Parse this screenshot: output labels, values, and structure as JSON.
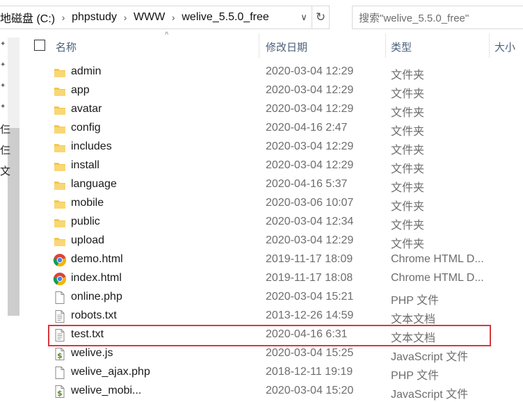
{
  "address_bar": {
    "crumbs": [
      "地磁盘 (C:)",
      "phpstudy",
      "WWW",
      "welive_5.5.0_free"
    ]
  },
  "search": {
    "placeholder": "搜索\"welive_5.5.0_free\""
  },
  "nav_pane": {
    "labels": [
      "仨",
      "仨",
      "文"
    ]
  },
  "columns": {
    "name": "名称",
    "date": "修改日期",
    "type": "类型",
    "size": "大小"
  },
  "files": [
    {
      "name": "admin",
      "date": "2020-03-04 12:29",
      "type": "文件夹",
      "icon": "folder-icon"
    },
    {
      "name": "app",
      "date": "2020-03-04 12:29",
      "type": "文件夹",
      "icon": "folder-icon"
    },
    {
      "name": "avatar",
      "date": "2020-03-04 12:29",
      "type": "文件夹",
      "icon": "folder-icon"
    },
    {
      "name": "config",
      "date": "2020-04-16 2:47",
      "type": "文件夹",
      "icon": "folder-icon"
    },
    {
      "name": "includes",
      "date": "2020-03-04 12:29",
      "type": "文件夹",
      "icon": "folder-icon"
    },
    {
      "name": "install",
      "date": "2020-03-04 12:29",
      "type": "文件夹",
      "icon": "folder-icon"
    },
    {
      "name": "language",
      "date": "2020-04-16 5:37",
      "type": "文件夹",
      "icon": "folder-icon"
    },
    {
      "name": "mobile",
      "date": "2020-03-06 10:07",
      "type": "文件夹",
      "icon": "folder-icon"
    },
    {
      "name": "public",
      "date": "2020-03-04 12:34",
      "type": "文件夹",
      "icon": "folder-icon"
    },
    {
      "name": "upload",
      "date": "2020-03-04 12:29",
      "type": "文件夹",
      "icon": "folder-icon"
    },
    {
      "name": "demo.html",
      "date": "2019-11-17 18:09",
      "type": "Chrome HTML D...",
      "icon": "chrome-icon"
    },
    {
      "name": "index.html",
      "date": "2019-11-17 18:08",
      "type": "Chrome HTML D...",
      "icon": "chrome-icon"
    },
    {
      "name": "online.php",
      "date": "2020-03-04 15:21",
      "type": "PHP 文件",
      "icon": "file-icon"
    },
    {
      "name": "robots.txt",
      "date": "2013-12-26 14:59",
      "type": "文本文档",
      "icon": "text-file-icon"
    },
    {
      "name": "test.txt",
      "date": "2020-04-16 6:31",
      "type": "文本文档",
      "icon": "text-file-icon"
    },
    {
      "name": "welive.js",
      "date": "2020-03-04 15:25",
      "type": "JavaScript 文件",
      "icon": "script-icon"
    },
    {
      "name": "welive_ajax.php",
      "date": "2018-12-11 19:19",
      "type": "PHP 文件",
      "icon": "file-icon"
    },
    {
      "name": "welive_mobi...",
      "date": "2020-03-04 15:20",
      "type": "JavaScript 文件",
      "icon": "script-icon"
    }
  ],
  "colors": {
    "highlight": "#d9363e",
    "folder": "#f3c74a",
    "header_text": "#4c607a"
  }
}
